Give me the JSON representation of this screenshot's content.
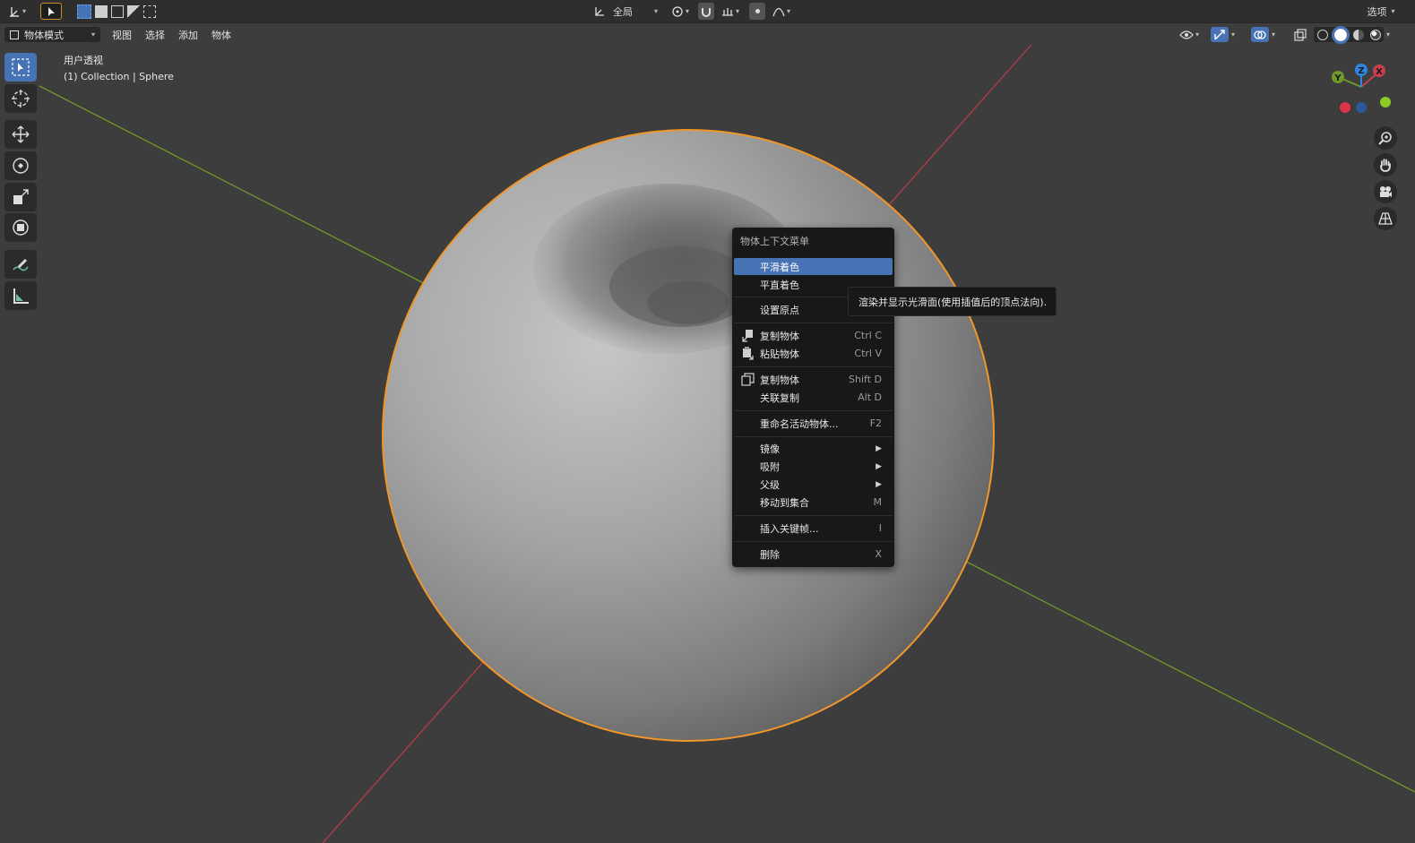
{
  "topbar": {
    "transform_orientation": "全局",
    "options_label": "选项"
  },
  "header": {
    "mode": "物体模式",
    "menus": [
      "视图",
      "选择",
      "添加",
      "物体"
    ]
  },
  "viewport": {
    "view_name": "用户透视",
    "object_info": "(1) Collection | Sphere"
  },
  "gizmo": {
    "axes": {
      "x": "X",
      "y": "Y",
      "z": "Z"
    }
  },
  "context_menu": {
    "title": "物体上下文菜单",
    "items": [
      {
        "label": "平滑着色",
        "shortcut": ""
      },
      {
        "label": "平直着色",
        "shortcut": ""
      },
      {
        "label": "设置原点",
        "shortcut": ""
      },
      {
        "label": "复制物体",
        "shortcut": "Ctrl C"
      },
      {
        "label": "粘贴物体",
        "shortcut": "Ctrl V"
      },
      {
        "label": "复制物体",
        "shortcut": "Shift D"
      },
      {
        "label": "关联复制",
        "shortcut": "Alt D"
      },
      {
        "label": "重命名活动物体...",
        "shortcut": "F2"
      },
      {
        "label": "镜像",
        "shortcut": ""
      },
      {
        "label": "吸附",
        "shortcut": ""
      },
      {
        "label": "父级",
        "shortcut": ""
      },
      {
        "label": "移动到集合",
        "shortcut": "M"
      },
      {
        "label": "插入关键帧...",
        "shortcut": "I"
      },
      {
        "label": "删除",
        "shortcut": "X"
      }
    ]
  },
  "tooltip": {
    "text": "渲染并显示光滑面(使用插值后的顶点法向)."
  },
  "colors": {
    "accent": "#4772b3",
    "selection_outline": "#f0962a",
    "axis_x": "#c8404f",
    "axis_y": "#6d9a28",
    "axis_z": "#2d86e0"
  }
}
